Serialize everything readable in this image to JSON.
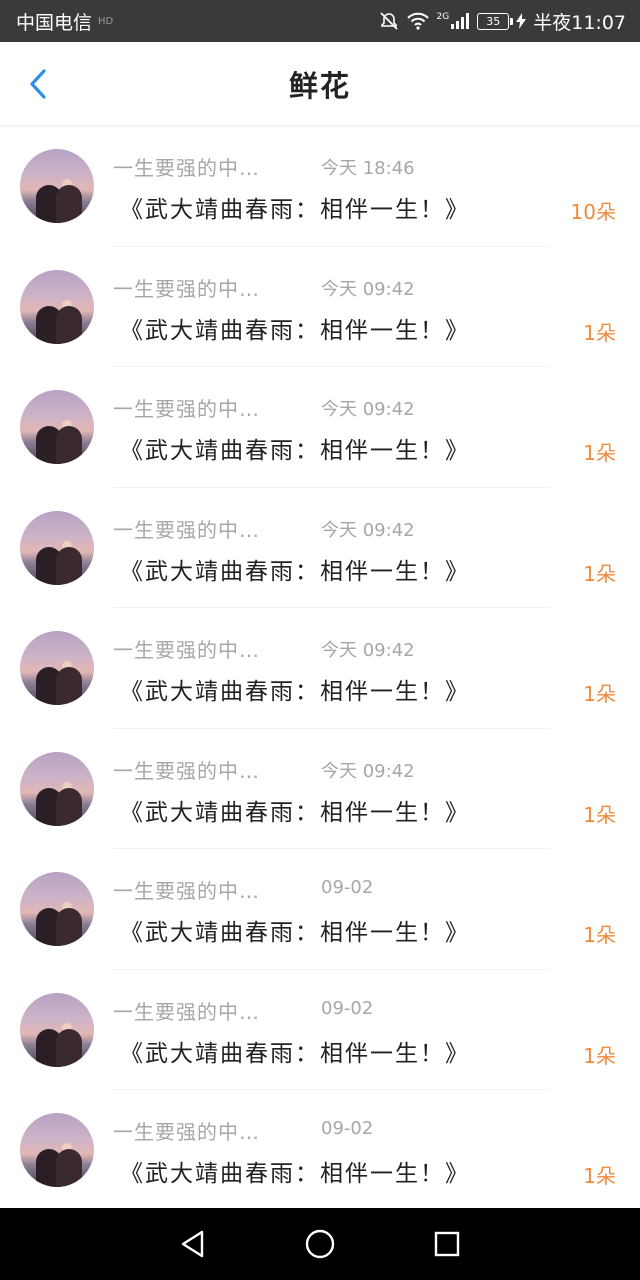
{
  "status_bar": {
    "carrier": "中国电信",
    "hd_label": "HD",
    "network": "2G",
    "battery": "35",
    "time": "半夜11:07"
  },
  "nav": {
    "title": "鲜花"
  },
  "items": [
    {
      "sender": "一生要强的中…",
      "time": "今天 18:46",
      "title": "《武大靖曲春雨：相伴一生！》",
      "count": "10朵"
    },
    {
      "sender": "一生要强的中…",
      "time": "今天 09:42",
      "title": "《武大靖曲春雨：相伴一生！》",
      "count": "1朵"
    },
    {
      "sender": "一生要强的中…",
      "time": "今天 09:42",
      "title": "《武大靖曲春雨：相伴一生！》",
      "count": "1朵"
    },
    {
      "sender": "一生要强的中…",
      "time": "今天 09:42",
      "title": "《武大靖曲春雨：相伴一生！》",
      "count": "1朵"
    },
    {
      "sender": "一生要强的中…",
      "time": "今天 09:42",
      "title": "《武大靖曲春雨：相伴一生！》",
      "count": "1朵"
    },
    {
      "sender": "一生要强的中…",
      "time": "今天 09:42",
      "title": "《武大靖曲春雨：相伴一生！》",
      "count": "1朵"
    },
    {
      "sender": "一生要强的中…",
      "time": "09-02",
      "title": "《武大靖曲春雨：相伴一生！》",
      "count": "1朵"
    },
    {
      "sender": "一生要强的中…",
      "time": "09-02",
      "title": "《武大靖曲春雨：相伴一生！》",
      "count": "1朵"
    },
    {
      "sender": "一生要强的中…",
      "time": "09-02",
      "title": "《武大靖曲春雨：相伴一生！》",
      "count": "1朵"
    }
  ],
  "colors": {
    "accent": "#2f8ee8",
    "count": "#f08a3c",
    "secondary_text": "#a7a7a7",
    "status_bar_bg": "#3a3a3a"
  },
  "icons": {
    "back": "chevron-left-icon",
    "mute": "bell-off-icon",
    "wifi": "wifi-icon",
    "signal": "signal-icon",
    "charging": "bolt-icon",
    "sys_back": "triangle-back-icon",
    "sys_home": "circle-home-icon",
    "sys_recent": "square-recent-icon"
  }
}
